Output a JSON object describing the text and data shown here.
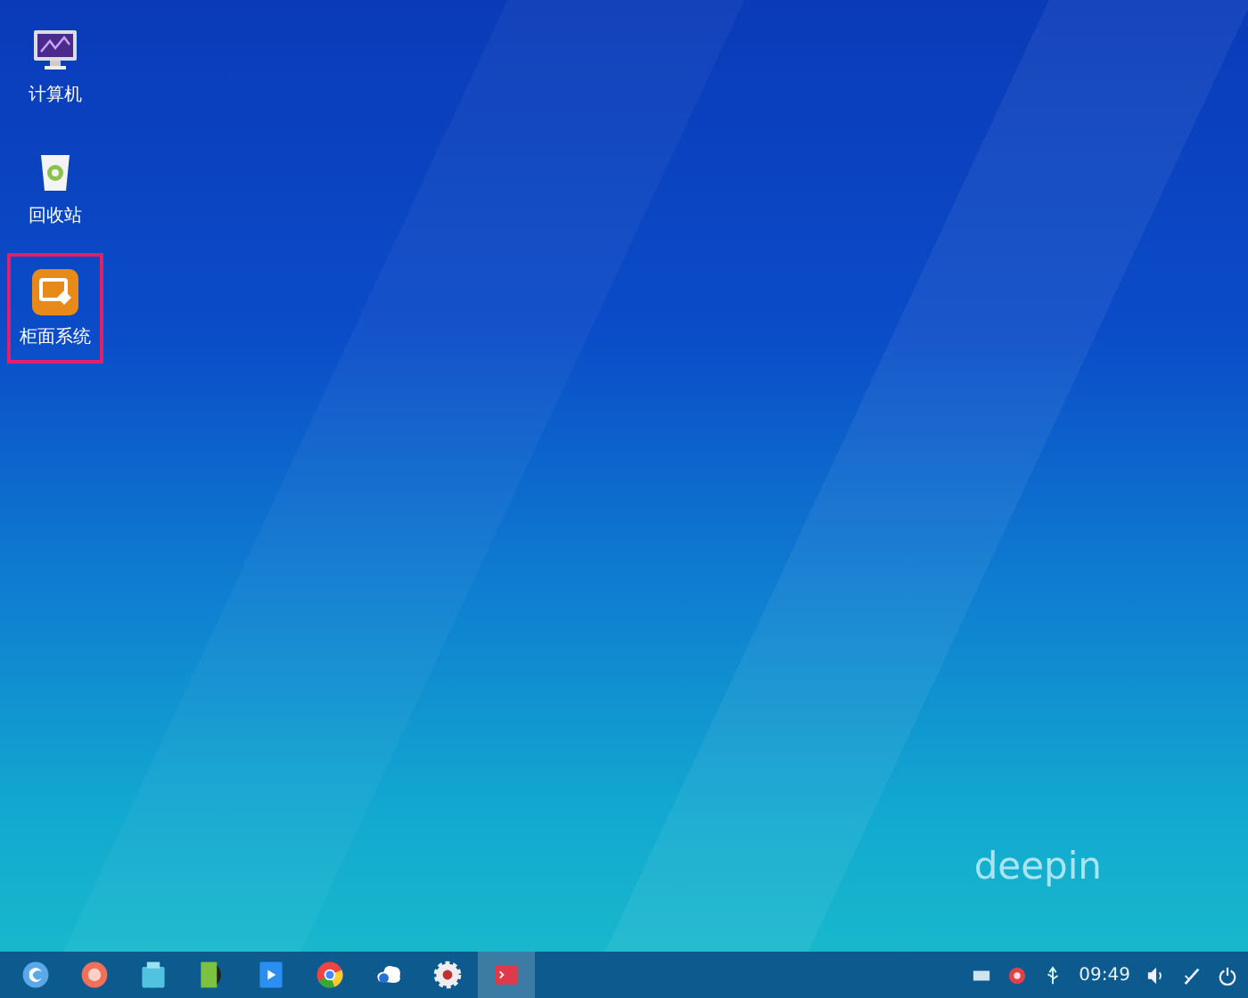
{
  "desktop": {
    "icons": [
      {
        "kind": "computer",
        "label": "计算机",
        "selected": false
      },
      {
        "kind": "trash",
        "label": "回收站",
        "selected": false
      },
      {
        "kind": "app",
        "label": "柜面系统",
        "selected": true
      }
    ],
    "wallpaper_logo": "deepin"
  },
  "taskbar": {
    "apps": [
      {
        "kind": "launcher",
        "active": false
      },
      {
        "kind": "recorder",
        "active": false
      },
      {
        "kind": "store",
        "active": false
      },
      {
        "kind": "document",
        "active": false
      },
      {
        "kind": "player",
        "active": false
      },
      {
        "kind": "browser",
        "active": false
      },
      {
        "kind": "chat",
        "active": false
      },
      {
        "kind": "settings",
        "active": false
      },
      {
        "kind": "terminal",
        "active": true
      }
    ],
    "tray": [
      {
        "kind": "keyboard"
      },
      {
        "kind": "record"
      },
      {
        "kind": "usb"
      }
    ],
    "clock": "09:49",
    "controls": [
      {
        "kind": "volume"
      },
      {
        "kind": "pen"
      },
      {
        "kind": "power"
      }
    ]
  }
}
